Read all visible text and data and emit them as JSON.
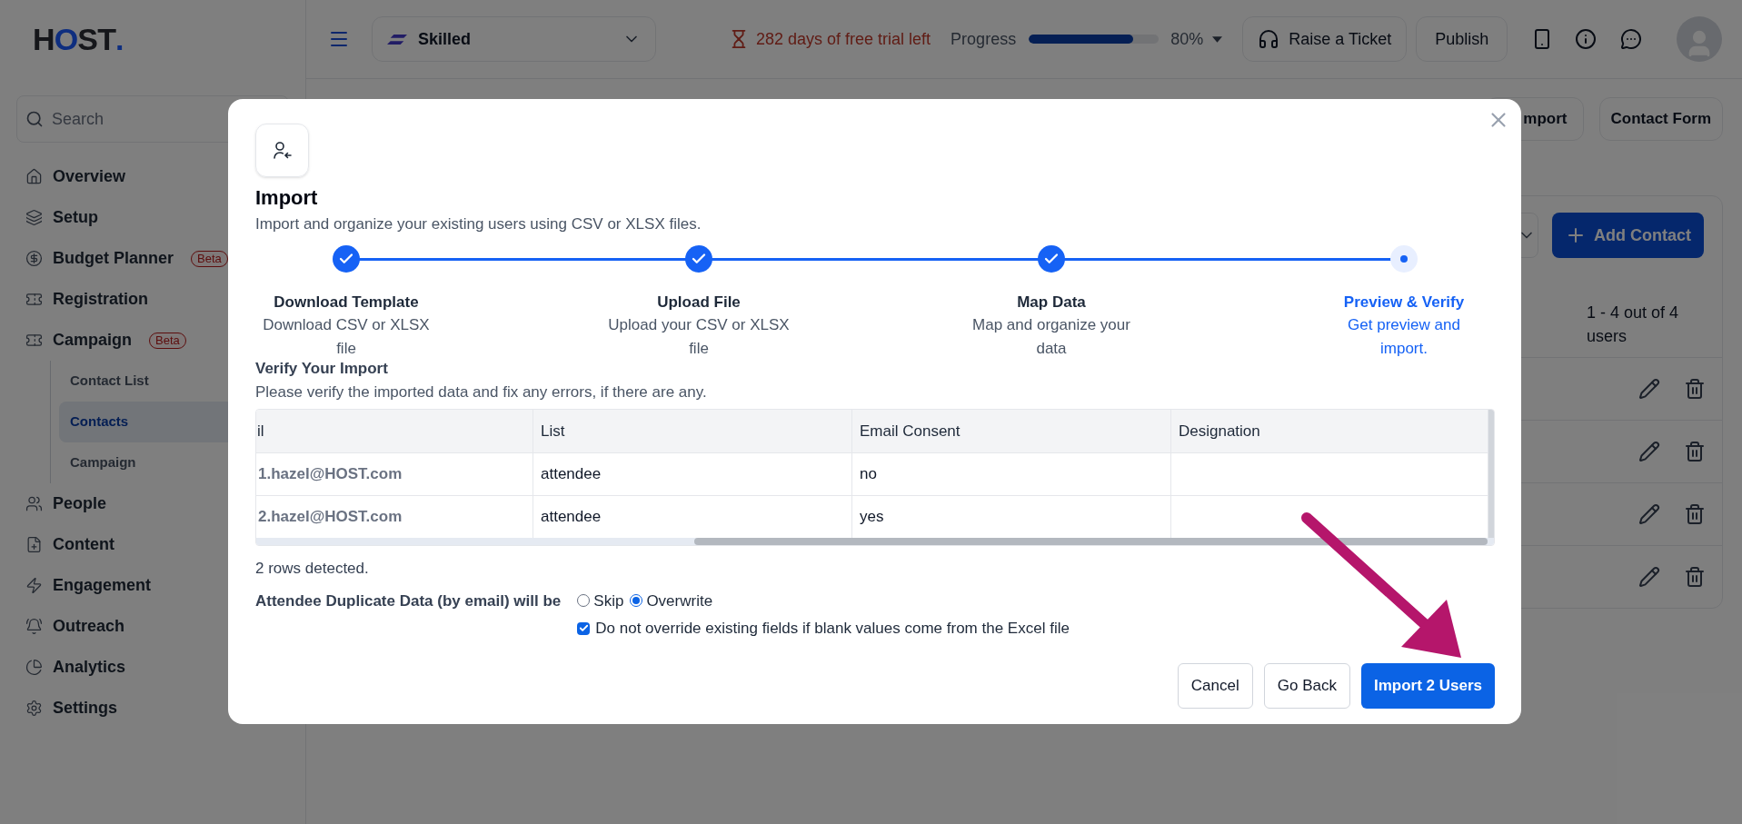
{
  "logo": {
    "parts": [
      {
        "text": "H",
        "accent": false
      },
      {
        "text": "O",
        "accent": true
      },
      {
        "text": "ST",
        "accent": false
      },
      {
        "text": ".",
        "accent": true
      }
    ]
  },
  "search": {
    "placeholder": "Search"
  },
  "sidebar": {
    "items": [
      {
        "label": "Overview",
        "selected": false
      },
      {
        "label": "Setup",
        "selected": false
      },
      {
        "label": "Budget Planner",
        "badge": "Beta",
        "selected": false
      },
      {
        "label": "Registration",
        "selected": false
      },
      {
        "label": "Campaign",
        "badge": "Beta",
        "selected": false,
        "children": [
          {
            "label": "Contact List",
            "selected": false
          },
          {
            "label": "Contacts",
            "selected": true
          },
          {
            "label": "Campaign",
            "selected": false
          }
        ]
      },
      {
        "label": "People",
        "selected": false
      },
      {
        "label": "Content",
        "selected": false
      },
      {
        "label": "Engagement",
        "selected": false
      },
      {
        "label": "Outreach",
        "selected": false
      },
      {
        "label": "Analytics",
        "selected": false
      },
      {
        "label": "Settings",
        "selected": false
      }
    ]
  },
  "header": {
    "event": "Skilled",
    "trial": "282 days of free trial left",
    "progress": {
      "label": "Progress",
      "level": 0.8,
      "reading": "80%"
    },
    "buttons": [
      "Raise a Ticket",
      "Publish"
    ]
  },
  "toolbar": {
    "buttons": [
      "mport",
      "Contact Form"
    ]
  },
  "contacts": {
    "add_button": "Add Contact",
    "count": "1 - 4 out of 4 users",
    "rows": [
      {
        "kind": "actions"
      },
      {
        "kind": "actions"
      },
      {
        "kind": "actions"
      },
      {
        "kind": "actions"
      }
    ]
  },
  "modal": {
    "title": "Import",
    "subtitle": "Import and organize your existing users using CSV or XLSX files.",
    "steps": [
      {
        "title": "Download Template",
        "description": "Download CSV or XLSX file",
        "completed": true,
        "current": false
      },
      {
        "title": "Upload File",
        "description": "Upload your CSV or XLSX file",
        "completed": true,
        "current": false
      },
      {
        "title": "Map Data",
        "description": "Map and organize your data",
        "completed": true,
        "current": false
      },
      {
        "title": "Preview & Verify",
        "description": "Get preview and import.",
        "completed": false,
        "current": true
      }
    ],
    "section_title": "Verify Your Import",
    "section_text": "Please verify the imported data and fix any errors, if there are any.",
    "table": {
      "columns": [
        "il",
        "List",
        "Email Consent",
        "Designation"
      ],
      "rows": [
        [
          "1.hazel@HOST.com",
          "attendee",
          "no",
          null
        ],
        [
          "2.hazel@HOST.com",
          "attendee",
          "yes",
          null
        ]
      ]
    },
    "rows_detected": "2 rows detected.",
    "duplicate": {
      "label": "Attendee Duplicate Data (by email) will be",
      "options": [
        {
          "label": "Skip",
          "selected": false
        },
        {
          "label": "Overwrite",
          "selected": true
        }
      ]
    },
    "keep_fields": {
      "label": "Do not override existing fields if blank values come from the Excel file",
      "checked": true
    },
    "buttons": [
      {
        "label": "Cancel",
        "kind": "secondary"
      },
      {
        "label": "Go Back",
        "kind": "secondary"
      },
      {
        "label": "Import 2 Users",
        "kind": "primary"
      }
    ]
  }
}
